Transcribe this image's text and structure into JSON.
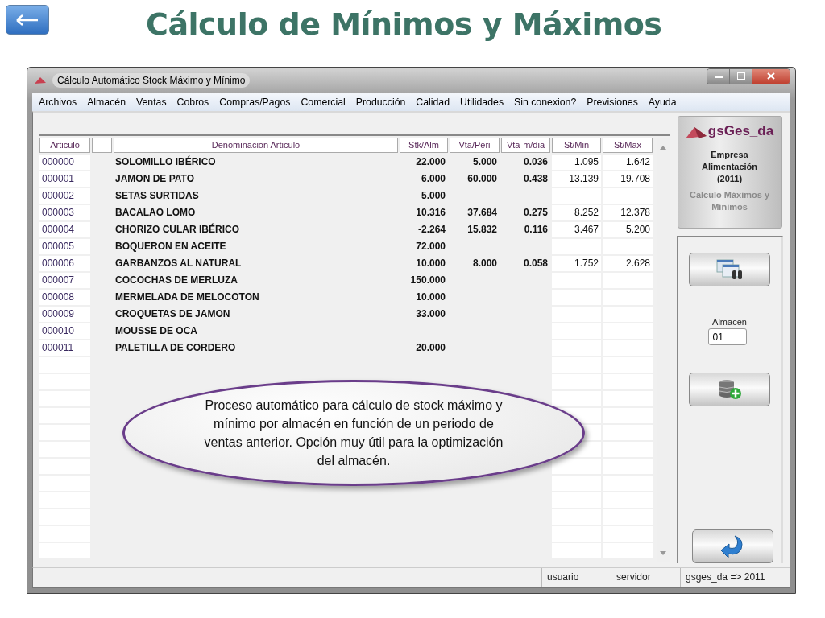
{
  "slide_title": "Cálculo de Mínimos y Máximos",
  "window": {
    "title": "Cálculo Automático Stock Máximo y Mínimo"
  },
  "menu": [
    "Archivos",
    "Almacén",
    "Ventas",
    "Cobros",
    "Compras/Pagos",
    "Comercial",
    "Producción",
    "Calidad",
    "Utilidades",
    "Sin conexion?",
    "Previsiones",
    "Ayuda"
  ],
  "table": {
    "columns": [
      "Articulo",
      "Denominacion Articulo",
      "Stk/Alm",
      "Vta/Peri",
      "Vta-m/dia",
      "St/Min",
      "St/Max"
    ],
    "rows": [
      {
        "articulo": "000000",
        "denominacion": "SOLOMILLO IBÉRICO",
        "stk_alm": "22.000",
        "vta_peri": "5.000",
        "vta_m_dia": "0.036",
        "st_min": "1.095",
        "st_max": "1.642"
      },
      {
        "articulo": "000001",
        "denominacion": "JAMON DE PATO",
        "stk_alm": "6.000",
        "vta_peri": "60.000",
        "vta_m_dia": "0.438",
        "st_min": "13.139",
        "st_max": "19.708"
      },
      {
        "articulo": "000002",
        "denominacion": "SETAS SURTIDAS",
        "stk_alm": "5.000"
      },
      {
        "articulo": "000003",
        "denominacion": "BACALAO LOMO",
        "stk_alm": "10.316",
        "vta_peri": "37.684",
        "vta_m_dia": "0.275",
        "st_min": "8.252",
        "st_max": "12.378"
      },
      {
        "articulo": "000004",
        "denominacion": "CHORIZO CULAR IBÉRICO",
        "stk_alm": "-2.264",
        "vta_peri": "15.832",
        "vta_m_dia": "0.116",
        "st_min": "3.467",
        "st_max": "5.200"
      },
      {
        "articulo": "000005",
        "denominacion": "BOQUERON EN ACEITE",
        "stk_alm": "72.000"
      },
      {
        "articulo": "000006",
        "denominacion": "GARBANZOS AL NATURAL",
        "stk_alm": "10.000",
        "vta_peri": "8.000",
        "vta_m_dia": "0.058",
        "st_min": "1.752",
        "st_max": "2.628"
      },
      {
        "articulo": "000007",
        "denominacion": "COCOCHAS DE MERLUZA",
        "stk_alm": "150.000"
      },
      {
        "articulo": "000008",
        "denominacion": "MERMELADA DE MELOCOTON",
        "stk_alm": "10.000"
      },
      {
        "articulo": "000009",
        "denominacion": "CROQUETAS DE JAMON",
        "stk_alm": "33.000"
      },
      {
        "articulo": "000010",
        "denominacion": "MOUSSE DE OCA"
      },
      {
        "articulo": "000011",
        "denominacion": "PALETILLA DE CORDERO",
        "stk_alm": "20.000"
      }
    ]
  },
  "side_panel": {
    "logo": "gsGes_da",
    "company": "Empresa Alimentación (2011)",
    "subtitle": "Calculo Máximos y Mínimos",
    "almacen_label": "Almacen",
    "almacen_value": "01"
  },
  "callout": "Proceso automático para cálculo de stock máximo y mínimo por almacén en función de un periodo de ventas anterior. Opción muy útil para la optimización del almacén.",
  "status_bar": [
    "usuario",
    "servidor",
    "gsges_da => 2011"
  ]
}
